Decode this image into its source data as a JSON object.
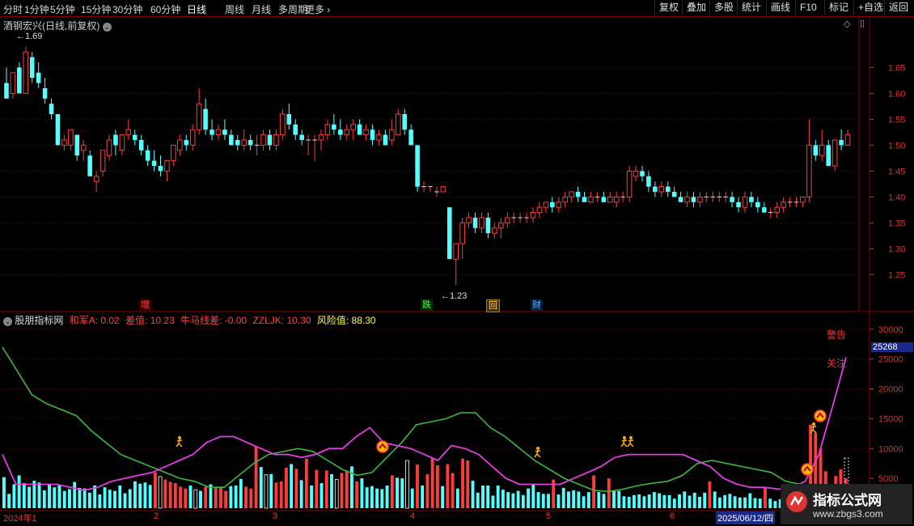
{
  "toolbar": {
    "left": [
      "分时",
      "1分钟",
      "5分钟",
      "15分钟",
      "30分钟",
      "60分钟",
      "日线",
      "周线",
      "月线",
      "多周期",
      "更多"
    ],
    "active": "日线",
    "right": [
      "复权",
      "叠加",
      "多股",
      "统计",
      "画线",
      "F10",
      "标记",
      "+自选",
      "返回"
    ]
  },
  "upper": {
    "title": "酒钢宏兴(日线,前复权)",
    "y_ticks": [
      "1.65",
      "1.60",
      "1.55",
      "1.50",
      "1.45",
      "1.40",
      "1.35",
      "1.30",
      "1.25"
    ],
    "high_label": "1.69",
    "low_label": "1.23",
    "markers": {
      "zeng": "增",
      "die": "跌",
      "hui": "回",
      "cai": "财"
    }
  },
  "lower": {
    "title": "股朋指标网",
    "readouts": [
      {
        "text": "和军A: 0.02",
        "color": "#ff4040"
      },
      {
        "text": "差值: 10.23",
        "color": "#ff4040"
      },
      {
        "text": "牛马线差: -0.00",
        "color": "#ff4040"
      },
      {
        "text": "ZZLJK: 10.30",
        "color": "#ff4040"
      },
      {
        "text": "风险值: 88.30",
        "color": "#ffff40"
      }
    ],
    "y_ticks": [
      "30000",
      "25000",
      "20000",
      "15000",
      "10000",
      "5000"
    ],
    "highlight_value": "25268",
    "warning": "警告",
    "attention": "关注"
  },
  "x_axis": {
    "labels": [
      "2024年1",
      "2",
      "3",
      "4",
      "5",
      "6"
    ],
    "cursor_date": "2025/06/12/四"
  },
  "watermark": {
    "line1": "指标公式网",
    "line2": "www.zbgs3.com"
  },
  "chart_data": {
    "type": "candlestick",
    "ohlc": [
      [
        1.62,
        1.65,
        1.59,
        1.59
      ],
      [
        1.6,
        1.64,
        1.59,
        1.64
      ],
      [
        1.65,
        1.66,
        1.6,
        1.6
      ],
      [
        1.6,
        1.69,
        1.6,
        1.68
      ],
      [
        1.67,
        1.68,
        1.62,
        1.63
      ],
      [
        1.64,
        1.66,
        1.61,
        1.62
      ],
      [
        1.61,
        1.63,
        1.58,
        1.59
      ],
      [
        1.58,
        1.59,
        1.55,
        1.56
      ],
      [
        1.56,
        1.56,
        1.5,
        1.5
      ],
      [
        1.5,
        1.52,
        1.49,
        1.51
      ],
      [
        1.5,
        1.53,
        1.49,
        1.53
      ],
      [
        1.52,
        1.52,
        1.47,
        1.48
      ],
      [
        1.49,
        1.51,
        1.47,
        1.5
      ],
      [
        1.48,
        1.49,
        1.44,
        1.44
      ],
      [
        1.43,
        1.45,
        1.41,
        1.44
      ],
      [
        1.45,
        1.49,
        1.44,
        1.49
      ],
      [
        1.48,
        1.52,
        1.47,
        1.51
      ],
      [
        1.52,
        1.53,
        1.48,
        1.5
      ],
      [
        1.49,
        1.52,
        1.48,
        1.52
      ],
      [
        1.52,
        1.55,
        1.51,
        1.53
      ],
      [
        1.52,
        1.53,
        1.5,
        1.51
      ],
      [
        1.51,
        1.52,
        1.48,
        1.49
      ],
      [
        1.49,
        1.5,
        1.46,
        1.47
      ],
      [
        1.47,
        1.49,
        1.45,
        1.46
      ],
      [
        1.46,
        1.48,
        1.44,
        1.45
      ],
      [
        1.45,
        1.47,
        1.43,
        1.47
      ],
      [
        1.47,
        1.5,
        1.46,
        1.5
      ],
      [
        1.49,
        1.52,
        1.48,
        1.51
      ],
      [
        1.51,
        1.52,
        1.49,
        1.5
      ],
      [
        1.5,
        1.54,
        1.49,
        1.53
      ],
      [
        1.53,
        1.61,
        1.52,
        1.58
      ],
      [
        1.57,
        1.59,
        1.52,
        1.53
      ],
      [
        1.53,
        1.55,
        1.51,
        1.52
      ],
      [
        1.52,
        1.54,
        1.51,
        1.53
      ],
      [
        1.53,
        1.55,
        1.51,
        1.52
      ],
      [
        1.52,
        1.53,
        1.5,
        1.5
      ],
      [
        1.51,
        1.52,
        1.49,
        1.5
      ],
      [
        1.5,
        1.53,
        1.49,
        1.51
      ],
      [
        1.51,
        1.52,
        1.49,
        1.5
      ],
      [
        1.5,
        1.52,
        1.48,
        1.5
      ],
      [
        1.5,
        1.53,
        1.49,
        1.52
      ],
      [
        1.52,
        1.53,
        1.49,
        1.5
      ],
      [
        1.5,
        1.53,
        1.49,
        1.52
      ],
      [
        1.52,
        1.57,
        1.51,
        1.56
      ],
      [
        1.56,
        1.58,
        1.53,
        1.54
      ],
      [
        1.54,
        1.55,
        1.51,
        1.52
      ],
      [
        1.52,
        1.53,
        1.5,
        1.51
      ],
      [
        1.51,
        1.52,
        1.48,
        1.51
      ],
      [
        1.51,
        1.52,
        1.47,
        1.51
      ],
      [
        1.51,
        1.53,
        1.49,
        1.52
      ],
      [
        1.52,
        1.55,
        1.51,
        1.54
      ],
      [
        1.54,
        1.56,
        1.52,
        1.53
      ],
      [
        1.53,
        1.55,
        1.51,
        1.52
      ],
      [
        1.52,
        1.54,
        1.51,
        1.53
      ],
      [
        1.53,
        1.55,
        1.51,
        1.54
      ],
      [
        1.54,
        1.55,
        1.52,
        1.52
      ],
      [
        1.52,
        1.54,
        1.51,
        1.53
      ],
      [
        1.53,
        1.54,
        1.5,
        1.51
      ],
      [
        1.51,
        1.53,
        1.5,
        1.52
      ],
      [
        1.52,
        1.53,
        1.5,
        1.5
      ],
      [
        1.51,
        1.55,
        1.5,
        1.53
      ],
      [
        1.52,
        1.57,
        1.52,
        1.56
      ],
      [
        1.56,
        1.57,
        1.52,
        1.53
      ],
      [
        1.53,
        1.54,
        1.5,
        1.5
      ],
      [
        1.5,
        1.5,
        1.41,
        1.42
      ],
      [
        1.42,
        1.43,
        1.41,
        1.42
      ],
      [
        1.42,
        1.42,
        1.41,
        1.42
      ],
      [
        1.41,
        1.42,
        1.4,
        1.41
      ],
      [
        1.41,
        1.42,
        1.41,
        1.42
      ],
      [
        1.38,
        1.38,
        1.3,
        1.28
      ],
      [
        1.28,
        1.31,
        1.23,
        1.31
      ],
      [
        1.31,
        1.36,
        1.28,
        1.35
      ],
      [
        1.35,
        1.37,
        1.34,
        1.36
      ],
      [
        1.36,
        1.37,
        1.33,
        1.34
      ],
      [
        1.34,
        1.37,
        1.33,
        1.36
      ],
      [
        1.36,
        1.37,
        1.32,
        1.33
      ],
      [
        1.33,
        1.35,
        1.32,
        1.34
      ],
      [
        1.34,
        1.36,
        1.32,
        1.35
      ],
      [
        1.35,
        1.37,
        1.34,
        1.36
      ],
      [
        1.36,
        1.37,
        1.35,
        1.36
      ],
      [
        1.36,
        1.37,
        1.35,
        1.36
      ],
      [
        1.36,
        1.37,
        1.35,
        1.36
      ],
      [
        1.36,
        1.38,
        1.35,
        1.37
      ],
      [
        1.37,
        1.39,
        1.36,
        1.38
      ],
      [
        1.38,
        1.39,
        1.37,
        1.39
      ],
      [
        1.39,
        1.4,
        1.37,
        1.38
      ],
      [
        1.38,
        1.4,
        1.37,
        1.39
      ],
      [
        1.39,
        1.41,
        1.38,
        1.4
      ],
      [
        1.4,
        1.41,
        1.39,
        1.41
      ],
      [
        1.41,
        1.42,
        1.39,
        1.4
      ],
      [
        1.4,
        1.41,
        1.39,
        1.39
      ],
      [
        1.39,
        1.41,
        1.39,
        1.4
      ],
      [
        1.4,
        1.41,
        1.39,
        1.4
      ],
      [
        1.4,
        1.41,
        1.39,
        1.39
      ],
      [
        1.39,
        1.41,
        1.39,
        1.4
      ],
      [
        1.39,
        1.41,
        1.38,
        1.4
      ],
      [
        1.4,
        1.41,
        1.39,
        1.4
      ],
      [
        1.4,
        1.46,
        1.39,
        1.45
      ],
      [
        1.44,
        1.46,
        1.43,
        1.45
      ],
      [
        1.45,
        1.46,
        1.43,
        1.44
      ],
      [
        1.44,
        1.45,
        1.41,
        1.42
      ],
      [
        1.42,
        1.43,
        1.4,
        1.41
      ],
      [
        1.41,
        1.43,
        1.4,
        1.42
      ],
      [
        1.42,
        1.43,
        1.4,
        1.41
      ],
      [
        1.41,
        1.42,
        1.4,
        1.4
      ],
      [
        1.4,
        1.41,
        1.39,
        1.39
      ],
      [
        1.39,
        1.41,
        1.38,
        1.4
      ],
      [
        1.4,
        1.41,
        1.38,
        1.39
      ],
      [
        1.39,
        1.41,
        1.38,
        1.4
      ],
      [
        1.4,
        1.41,
        1.39,
        1.4
      ],
      [
        1.4,
        1.41,
        1.39,
        1.4
      ],
      [
        1.4,
        1.41,
        1.39,
        1.4
      ],
      [
        1.4,
        1.41,
        1.39,
        1.4
      ],
      [
        1.4,
        1.41,
        1.38,
        1.39
      ],
      [
        1.39,
        1.4,
        1.37,
        1.38
      ],
      [
        1.38,
        1.41,
        1.37,
        1.4
      ],
      [
        1.4,
        1.41,
        1.38,
        1.39
      ],
      [
        1.39,
        1.4,
        1.37,
        1.38
      ],
      [
        1.38,
        1.39,
        1.37,
        1.37
      ],
      [
        1.37,
        1.38,
        1.36,
        1.37
      ],
      [
        1.37,
        1.39,
        1.36,
        1.38
      ],
      [
        1.38,
        1.4,
        1.37,
        1.39
      ],
      [
        1.39,
        1.4,
        1.38,
        1.39
      ],
      [
        1.39,
        1.4,
        1.38,
        1.39
      ],
      [
        1.39,
        1.4,
        1.38,
        1.4
      ],
      [
        1.4,
        1.55,
        1.39,
        1.5
      ],
      [
        1.5,
        1.51,
        1.47,
        1.48
      ],
      [
        1.48,
        1.53,
        1.47,
        1.5
      ],
      [
        1.5,
        1.51,
        1.46,
        1.46
      ],
      [
        1.46,
        1.51,
        1.45,
        1.51
      ],
      [
        1.51,
        1.53,
        1.49,
        1.5
      ],
      [
        1.5,
        1.53,
        1.5,
        1.52
      ]
    ],
    "y_range": [
      1.21,
      1.71
    ],
    "indicator": {
      "y_range": [
        0,
        32000
      ],
      "volume": [
        5200,
        2400,
        4000,
        5500,
        4200,
        3600,
        4600,
        4300,
        3000,
        4100,
        3500,
        3900,
        2900,
        3200,
        4400,
        3400,
        3300,
        2600,
        3800,
        2300,
        3500,
        3100,
        2900,
        3800,
        2500,
        3200,
        4500,
        4100,
        4300,
        3900,
        6000,
        5300,
        4800,
        4400,
        4200,
        3600,
        3300,
        3800,
        3100,
        2900,
        3600,
        4000,
        3500,
        3400,
        2900,
        3700,
        3800,
        4900,
        3600,
        3300,
        10300,
        6900,
        5600,
        5700,
        4300,
        4500,
        6800,
        7400,
        6600,
        4700,
        8300,
        3800,
        6400,
        4200,
        6300,
        5700,
        4800,
        5900,
        6300,
        7000,
        4500,
        5000,
        3500,
        3700,
        3300,
        3200,
        3800,
        5500,
        5100,
        5000,
        8000,
        3300,
        7300,
        3800,
        5700,
        8400,
        7200,
        3700,
        7400,
        5900,
        3300,
        8300,
        8000,
        4600,
        2600,
        3800,
        3800,
        2100,
        3800,
        3100,
        2700,
        2500,
        2900,
        2200,
        3300,
        4100,
        2700,
        2400,
        2400,
        4800,
        2300,
        3400,
        2800,
        3000,
        2800,
        2000,
        2700,
        5500,
        2700,
        2400,
        5000,
        3000,
        2900,
        2000,
        1900,
        2200,
        2300,
        2000,
        2300,
        2700,
        2500,
        2200,
        2200,
        1600,
        2300,
        2800,
        2100,
        2600,
        1900,
        2600,
        4500,
        2800,
        1800,
        2200,
        2400,
        2000,
        1800,
        1800,
        2500,
        1700,
        1600,
        3400,
        1600,
        1200,
        1500,
        1400,
        1300,
        2400,
        4100,
        3000,
        14000,
        12600,
        10000,
        6200,
        4000,
        5400,
        6500,
        5000
      ],
      "volume_up": [
        0,
        0,
        0,
        0,
        0,
        0,
        0,
        0,
        0,
        0,
        0,
        0,
        0,
        0,
        0,
        0,
        0,
        0,
        0,
        0,
        0,
        0,
        0,
        0,
        0,
        0,
        0,
        0,
        0,
        0,
        1,
        1,
        1,
        1,
        1,
        1,
        1,
        0,
        1,
        0,
        1,
        0,
        1,
        1,
        1,
        0,
        0,
        0,
        1,
        1,
        1,
        0,
        1,
        0,
        1,
        1,
        1,
        0,
        1,
        0,
        1,
        0,
        1,
        0,
        1,
        0,
        1,
        1,
        1,
        0,
        1,
        0,
        0,
        0,
        0,
        0,
        0,
        1,
        0,
        0,
        1,
        0,
        1,
        0,
        1,
        1,
        1,
        0,
        1,
        1,
        0,
        1,
        1,
        0,
        0,
        0,
        0,
        0,
        0,
        0,
        0,
        0,
        0,
        0,
        0,
        0,
        0,
        0,
        0,
        1,
        0,
        0,
        0,
        0,
        0,
        0,
        0,
        1,
        0,
        0,
        1,
        0,
        0,
        0,
        0,
        0,
        0,
        0,
        0,
        0,
        0,
        0,
        0,
        0,
        0,
        0,
        0,
        0,
        0,
        0,
        1,
        0,
        0,
        0,
        0,
        0,
        0,
        0,
        0,
        0,
        0,
        1,
        0,
        0,
        0,
        0,
        0,
        0,
        1,
        1,
        1,
        1,
        1,
        1,
        1,
        1,
        1,
        1
      ],
      "green_line": [
        27000,
        23000,
        19000,
        17500,
        16500,
        15500,
        13000,
        11000,
        9000,
        8000,
        7000,
        6000,
        5000,
        4500,
        3500,
        3500,
        5500,
        7500,
        9000,
        9500,
        10000,
        9500,
        8000,
        6500,
        5500,
        6000,
        8500,
        11000,
        14000,
        14500,
        15000,
        16000,
        16000,
        13500,
        12000,
        10000,
        8000,
        6500,
        5000,
        4000,
        3000,
        2800,
        3200,
        3800,
        4200,
        4500,
        5500,
        7500,
        8000,
        7500,
        7000,
        6500,
        6000,
        4500,
        4000
      ],
      "magenta_line": [
        9000,
        4000,
        4000,
        4000,
        4000,
        3500,
        3000,
        3500,
        4500,
        5000,
        5500,
        6000,
        7000,
        8000,
        9000,
        11000,
        12000,
        12000,
        11000,
        10000,
        9000,
        9000,
        8500,
        9000,
        10000,
        10000,
        12000,
        13500,
        11000,
        10500,
        10000,
        9000,
        8000,
        10500,
        10000,
        9000,
        7000,
        5000,
        4000,
        4000,
        4000,
        4000,
        5000,
        6000,
        7000,
        8500,
        9000,
        9000,
        9000,
        9000,
        9000,
        8000,
        7000,
        5000,
        4000,
        3500,
        3500,
        3200,
        3400,
        4500,
        9000,
        17000,
        25268
      ]
    }
  }
}
